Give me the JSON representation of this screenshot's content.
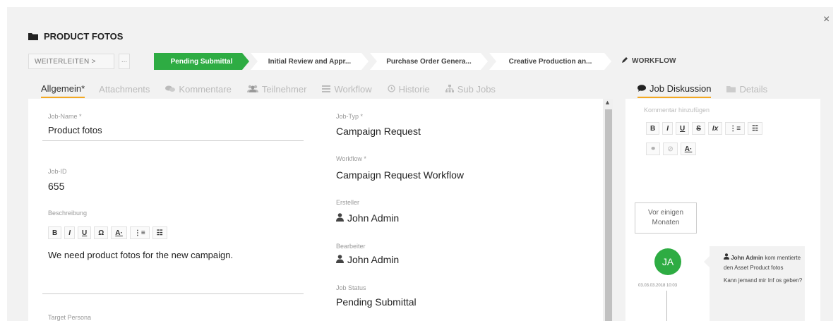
{
  "window": {
    "title": "PRODUCT FOTOS",
    "close_symbol": "×"
  },
  "actions": {
    "forward_label": "WEITERLEITEN >",
    "more_label": "..."
  },
  "workflow_steps": [
    {
      "label": "Pending Submittal",
      "active": true
    },
    {
      "label": "Initial Review and Appr...",
      "active": false
    },
    {
      "label": "Purchase Order Genera...",
      "active": false
    },
    {
      "label": "Creative Production an...",
      "active": false
    }
  ],
  "workflow_link": {
    "label": "WORKFLOW",
    "icon": "pencil-icon"
  },
  "tabs": [
    {
      "label": "Allgemein*",
      "icon": "",
      "active": true
    },
    {
      "label": "Attachments",
      "icon": "",
      "active": false
    },
    {
      "label": "Kommentare",
      "icon": "comments-icon",
      "active": false
    },
    {
      "label": "Teilnehmer",
      "icon": "users-icon",
      "active": false
    },
    {
      "label": "Workflow",
      "icon": "list-icon",
      "active": false
    },
    {
      "label": "Historie",
      "icon": "history-icon",
      "active": false
    },
    {
      "label": "Sub Jobs",
      "icon": "sitemap-icon",
      "active": false
    }
  ],
  "right_tabs": [
    {
      "label": "Job Diskussion",
      "icon": "comment-icon",
      "active": true
    },
    {
      "label": "Details",
      "icon": "folder-icon",
      "active": false
    }
  ],
  "form": {
    "job_name": {
      "label": "Job-Name *",
      "value": "Product fotos"
    },
    "job_id": {
      "label": "Job-ID",
      "value": "655"
    },
    "description": {
      "label": "Beschreibung",
      "value": "We need product fotos for the new campaign."
    },
    "target_persona": {
      "label": "Target Persona"
    },
    "job_type": {
      "label": "Job-Typ *",
      "value": "Campaign Request"
    },
    "workflow": {
      "label": "Workflow *",
      "value": "Campaign Request Workflow"
    },
    "creator": {
      "label": "Ersteller",
      "value": "John Admin"
    },
    "editor": {
      "label": "Bearbeiter",
      "value": "John Admin"
    },
    "status": {
      "label": "Job Status",
      "value": "Pending Submittal"
    }
  },
  "editor_toolbar": [
    "B",
    "I",
    "U",
    "Ω",
    "A·",
    "⋮≡",
    "☷"
  ],
  "discussion": {
    "placeholder": "Kommentar hinzufügen",
    "toolbar_row1": [
      "B",
      "I",
      "U",
      "S",
      "Ix",
      "⋮≡",
      "☷"
    ],
    "toolbar_row2": [
      "⚭",
      "⊘",
      "A·"
    ],
    "time_ago": "Vor einigen Monaten",
    "avatar_initials": "JA",
    "timestamp": "03.03.03.2018 10:03",
    "author": "John Admin",
    "action_text": "kom mentierte den Asset Product fotos",
    "message": "Kann jemand mir Inf os geben?"
  },
  "colors": {
    "accent_green": "#2eac43",
    "tab_underline": "#f3a823"
  }
}
